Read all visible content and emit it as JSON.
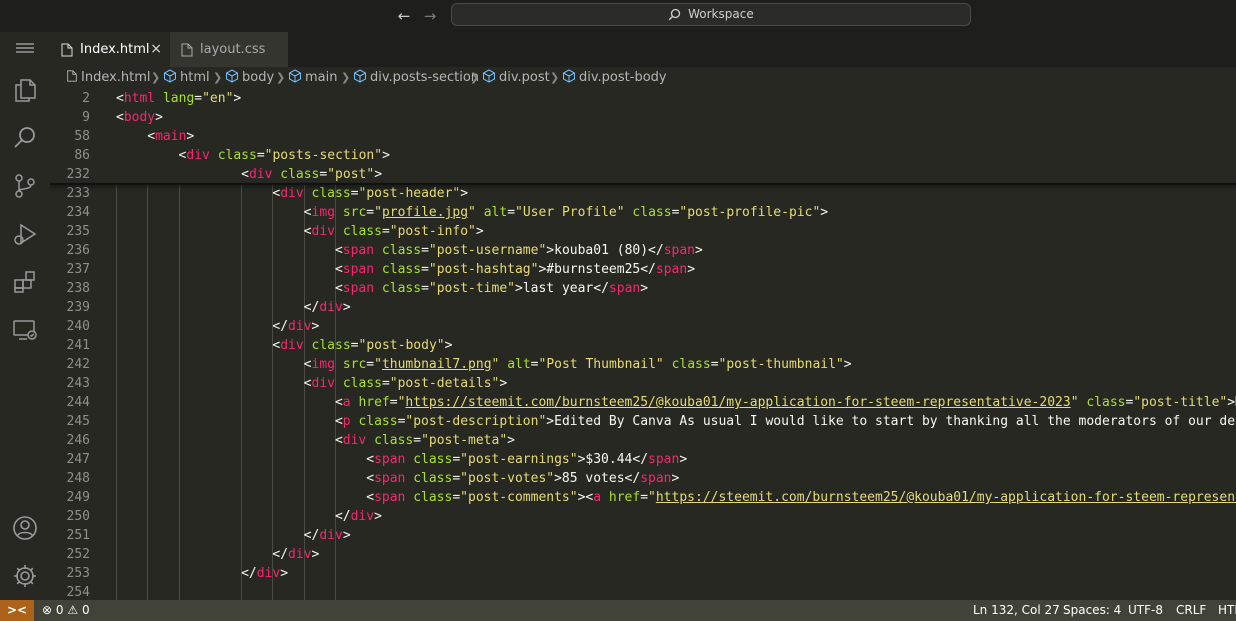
{
  "titlebar": {
    "search_text": "Workspace",
    "back_icon": "arrow-left-icon",
    "forward_icon": "arrow-right-icon"
  },
  "activity_bar": {
    "items": [
      "explorer-icon",
      "search-icon",
      "source-control-icon",
      "run-debug-icon",
      "extensions-icon",
      "remote-explorer-icon"
    ],
    "bottom": [
      "account-icon",
      "settings-gear-icon"
    ]
  },
  "tabs": [
    {
      "label": "Index.html",
      "active": true
    },
    {
      "label": "layout.css",
      "active": false
    }
  ],
  "tab_close_glyph": "×",
  "breadcrumb": [
    "Index.html",
    "html",
    "body",
    "main",
    "div.posts-section",
    "div.post",
    "div.post-body"
  ],
  "sticky_lines": [
    {
      "n": "2",
      "code": "<html lang=\"en\">"
    },
    {
      "n": "9",
      "code": "<body>"
    },
    {
      "n": "58",
      "code": "<main>"
    },
    {
      "n": "86",
      "code": "<div class=\"posts-section\">"
    },
    {
      "n": "232",
      "code": "<div class=\"post\">"
    }
  ],
  "lines": [
    {
      "n": "233",
      "code": "<div class=\"post-header\">"
    },
    {
      "n": "234",
      "code": "<img src=\"profile.jpg\" alt=\"User Profile\" class=\"post-profile-pic\">"
    },
    {
      "n": "235",
      "code": "<div class=\"post-info\">"
    },
    {
      "n": "236",
      "code": "<span class=\"post-username\">kouba01 (80)</span>"
    },
    {
      "n": "237",
      "code": "<span class=\"post-hashtag\">#burnsteem25</span>"
    },
    {
      "n": "238",
      "code": "<span class=\"post-time\">last year</span>"
    },
    {
      "n": "239",
      "code": "</div>"
    },
    {
      "n": "240",
      "code": "</div>"
    },
    {
      "n": "241",
      "code": "<div class=\"post-body\">"
    },
    {
      "n": "242",
      "code": "<img src=\"thumbnail7.png\" alt=\"Post Thumbnail\" class=\"post-thumbnail\">"
    },
    {
      "n": "243",
      "code": "<div class=\"post-details\">"
    },
    {
      "n": "244",
      "code": "<a href=\"https://steemit.com/burnsteem25/@kouba01/my-application-for-steem-representative-2023\" class=\"post-title\">My"
    },
    {
      "n": "245",
      "code": "<p class=\"post-description\">Edited By Canva As usual I would like to start by thanking all the moderators of our dear"
    },
    {
      "n": "246",
      "code": "<div class=\"post-meta\">"
    },
    {
      "n": "247",
      "code": "<span class=\"post-earnings\">$30.44</span>"
    },
    {
      "n": "248",
      "code": "<span class=\"post-votes\">85 votes</span>"
    },
    {
      "n": "249",
      "code": "<span class=\"post-comments\"><a href=\"https://steemit.com/burnsteem25/@kouba01/my-application-for-steem-representa"
    },
    {
      "n": "250",
      "code": "</div>"
    },
    {
      "n": "251",
      "code": "</div>"
    },
    {
      "n": "252",
      "code": "</div>"
    },
    {
      "n": "253",
      "code": "</div>"
    },
    {
      "n": "254",
      "code": ""
    }
  ],
  "status_bar": {
    "remote_glyph": "><",
    "errors": "0",
    "warnings": "0",
    "position": "Ln 132, Col 27",
    "spaces": "Spaces: 4",
    "encoding": "UTF-8",
    "eol": "CRLF",
    "language": "HTML"
  },
  "colors": {
    "tag": "#f92672",
    "attribute": "#a6e22e",
    "string": "#e6db74",
    "text": "#f8f8f2",
    "background": "#272822",
    "remote_badge": "#ac6218"
  }
}
